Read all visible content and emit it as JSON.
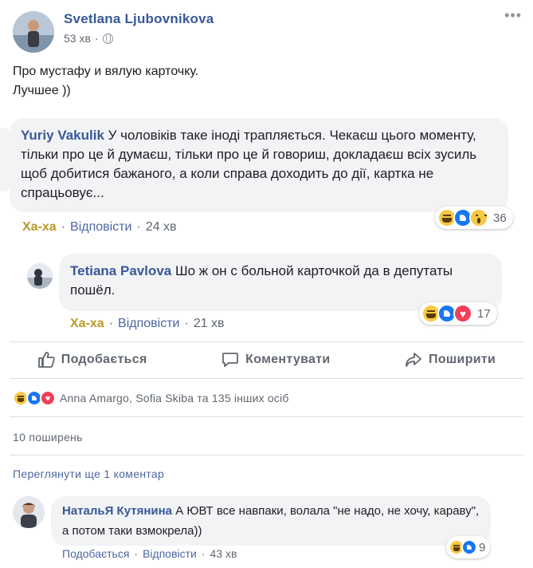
{
  "post": {
    "author": "Svetlana Ljubovnikova",
    "time": "53 хв",
    "separator": "·",
    "text_line1": "Про мустафу и вялую карточку.",
    "text_line2": "Лучшее ))"
  },
  "comments": [
    {
      "name": "Yuriy Vakulik",
      "text": "У чоловіків таке іноді трапляється. Чекаєш цього моменту, тільки про це й думаєш, тільки про це й говориш, докладаєш всіх зусиль щоб добитися бажаного, а коли справа доходить до дії, картка не спрацьовує...",
      "reaction_label": "Ха-ха",
      "reply_label": "Відповісти",
      "time": "24 хв",
      "reaction_count": "36",
      "reactions": [
        "haha",
        "like",
        "wow"
      ]
    },
    {
      "name": "Tetiana Pavlova",
      "text": "Шо ж он с больной карточкой да в депутаты пошёл.",
      "reaction_label": "Ха-ха",
      "reply_label": "Відповісти",
      "time": "21 хв",
      "reaction_count": "17",
      "reactions": [
        "haha",
        "like",
        "love"
      ]
    },
    {
      "name": "НатальЯ Кутянина",
      "text": "А ЮВТ все навпаки, волала \"не надо, не хочу, караву\", а потом таки взмокрела))",
      "reaction_label": "Подобається",
      "reply_label": "Відповісти",
      "time": "43 хв",
      "reaction_count": "9",
      "reactions": [
        "haha",
        "like"
      ]
    }
  ],
  "action_bar": {
    "like": "Подобається",
    "comment": "Коментувати",
    "share": "Поширити"
  },
  "summary": {
    "reactions": [
      "haha",
      "like",
      "love"
    ],
    "names": "Anna Amargo, Sofia Skiba та 135 інших осіб"
  },
  "shares": "10 поширень",
  "more_comments": "Переглянути ще 1 коментар",
  "colors": {
    "link": "#385898",
    "haha_label": "#b89a2a",
    "bubble": "#f2f3f5",
    "like_blue": "#1877f2",
    "love_red": "#f33e58",
    "haha_yellow": "#f7c844"
  }
}
